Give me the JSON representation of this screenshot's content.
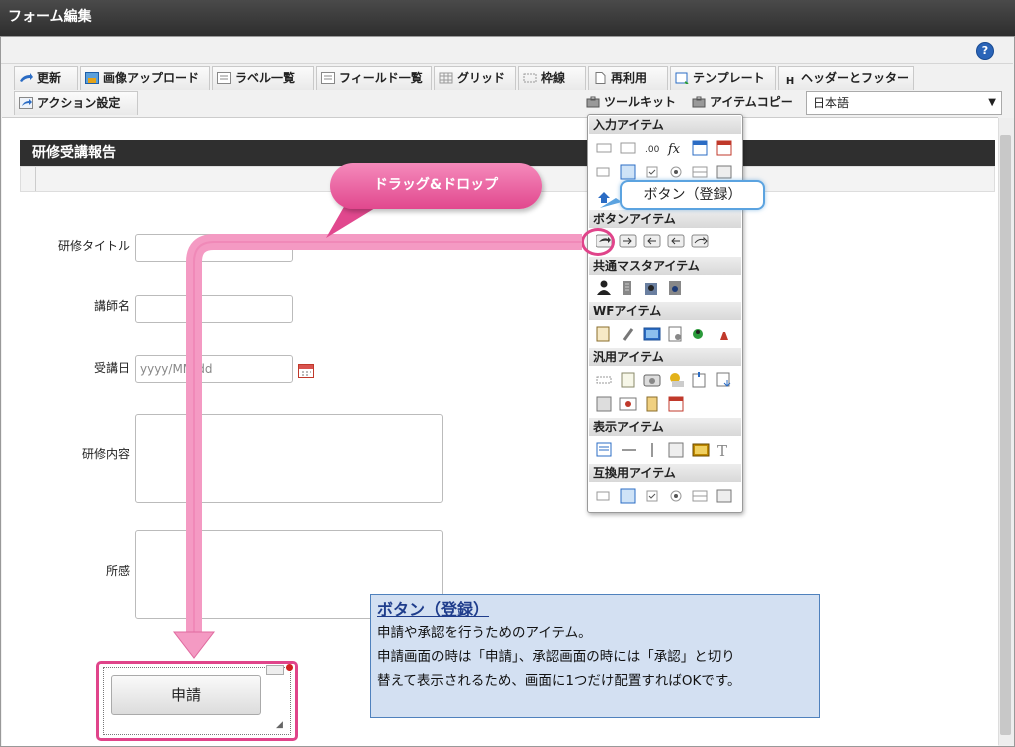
{
  "window": {
    "title": "フォーム編集"
  },
  "help_icon": "?",
  "toolbar": {
    "row1": [
      {
        "label": "更新",
        "icon": "refresh-icon"
      },
      {
        "label": "画像アップロード",
        "icon": "image-upload-icon"
      },
      {
        "label": "ラベル一覧",
        "icon": "label-list-icon"
      },
      {
        "label": "フィールド一覧",
        "icon": "field-list-icon"
      },
      {
        "label": "グリッド",
        "icon": "grid-icon"
      },
      {
        "label": "枠線",
        "icon": "border-icon"
      },
      {
        "label": "再利用",
        "icon": "reuse-icon"
      },
      {
        "label": "テンプレート",
        "icon": "template-icon"
      },
      {
        "label": "ヘッダーとフッター",
        "icon": "header-footer-icon"
      }
    ],
    "row2_left": {
      "label": "アクション設定",
      "icon": "action-icon"
    },
    "toolkit": {
      "label": "ツールキット",
      "icon": "toolkit-icon"
    },
    "item_copy": {
      "label": "アイテムコピー",
      "icon": "item-copy-icon"
    },
    "language": {
      "value": "日本語"
    }
  },
  "form": {
    "title": "研修受講報告",
    "fields": {
      "title_label": "研修タイトル",
      "instructor_label": "講師名",
      "date_label": "受講日",
      "date_placeholder": "yyyy/MM/dd",
      "content_label": "研修内容",
      "impression_label": "所感"
    },
    "apply_button": "申請"
  },
  "toolkit_panel": {
    "sections": [
      "入力アイテム",
      "ボタンアイテム",
      "共通マスタアイテム",
      "WFアイテム",
      "汎用アイテム",
      "表示アイテム",
      "互換用アイテム"
    ]
  },
  "callout": {
    "text": "ドラッグ&ドロップ"
  },
  "tooltip": {
    "text": "ボタン（登録）"
  },
  "description": {
    "title": "ボタン（登録）",
    "lines": [
      "申請や承認を行うためのアイテム。",
      "申請画面の時は「申請」、承認画面の時には「承認」と切り",
      "替えて表示されるため、画面に1つだけ配置すればOKです。"
    ]
  },
  "colors": {
    "accent_pink": "#e0448a",
    "info_blue": "#4f81bd",
    "header_dark": "#2f2f2f"
  }
}
